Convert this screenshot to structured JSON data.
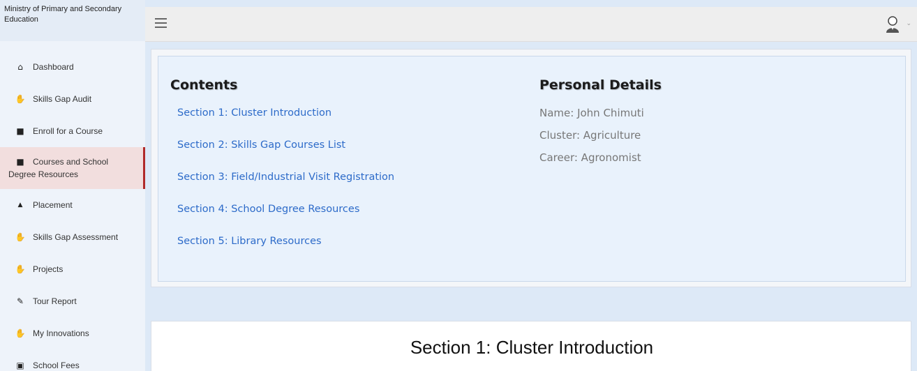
{
  "brand": {
    "title": "Ministry of Primary and Secondary Education"
  },
  "sidebar": {
    "items": [
      {
        "label": "Dashboard",
        "icon": "home-icon"
      },
      {
        "label": "Skills Gap Audit",
        "icon": "handshake-icon"
      },
      {
        "label": "Enroll for a Course",
        "icon": "bookmark-icon"
      },
      {
        "label_line1": "Courses and School",
        "label_line2": "Degree Resources",
        "icon": "bookmark-icon",
        "active": true
      },
      {
        "label": "Placement",
        "icon": "triangle-up-icon"
      },
      {
        "label": "Skills Gap Assessment",
        "icon": "handshake-icon"
      },
      {
        "label": "Projects",
        "icon": "handshake-icon"
      },
      {
        "label": "Tour Report",
        "icon": "edit-icon"
      },
      {
        "label": "My Innovations",
        "icon": "handshake-icon"
      },
      {
        "label": "School Fees",
        "icon": "money-icon"
      }
    ]
  },
  "contents": {
    "heading": "Contents",
    "links": [
      "Section 1: Cluster Introduction",
      "Section 2: Skills Gap Courses List",
      "Section 3: Field/Industrial Visit Registration",
      "Section 4: School Degree Resources",
      "Section 5: Library Resources"
    ]
  },
  "personal": {
    "heading": "Personal Details",
    "name": "Name: John Chimuti",
    "cluster": "Cluster: Agriculture",
    "career": "Career: Agronomist"
  },
  "section": {
    "title": "Section 1: Cluster Introduction"
  },
  "colors": {
    "link": "#2d6bc9",
    "active_border": "#b02a2a",
    "active_bg": "#f2dede"
  }
}
